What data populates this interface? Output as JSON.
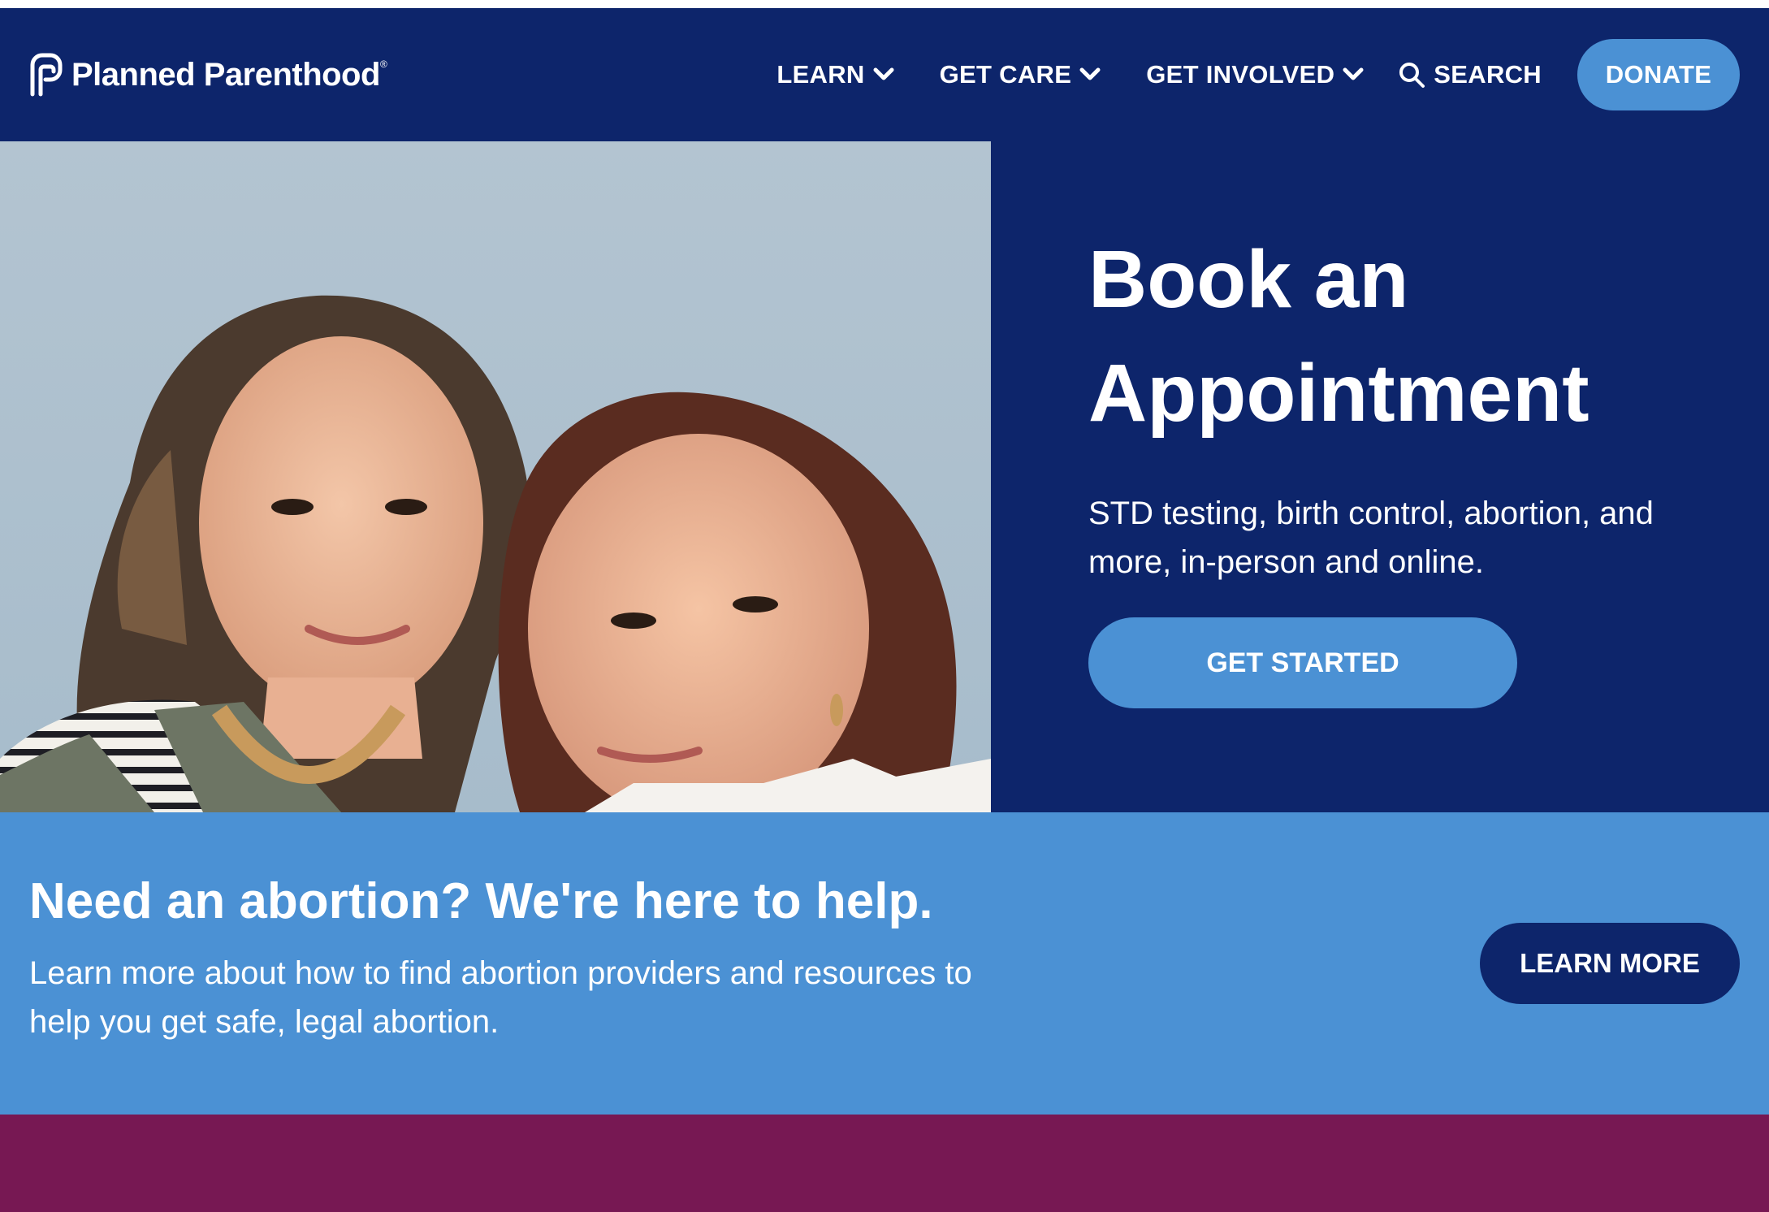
{
  "brand": {
    "name": "Planned Parenthood",
    "mark": "®"
  },
  "nav": {
    "items": [
      {
        "label": "LEARN"
      },
      {
        "label": "GET CARE"
      },
      {
        "label": "GET INVOLVED"
      }
    ],
    "search_label": "SEARCH",
    "donate_label": "DONATE"
  },
  "hero": {
    "title_line1": "Book an",
    "title_line2": "Appointment",
    "subtitle": "STD testing, birth control, abortion, and more, in-person and online.",
    "cta_label": "GET STARTED"
  },
  "banner": {
    "title": "Need an abortion? We're here to help.",
    "subtitle": "Learn more about how to find abortion providers and resources to help you get safe, legal abortion.",
    "button_label": "LEARN MORE"
  },
  "colors": {
    "navy": "#0d256b",
    "light_blue": "#4b91d4",
    "plum": "#771853"
  }
}
